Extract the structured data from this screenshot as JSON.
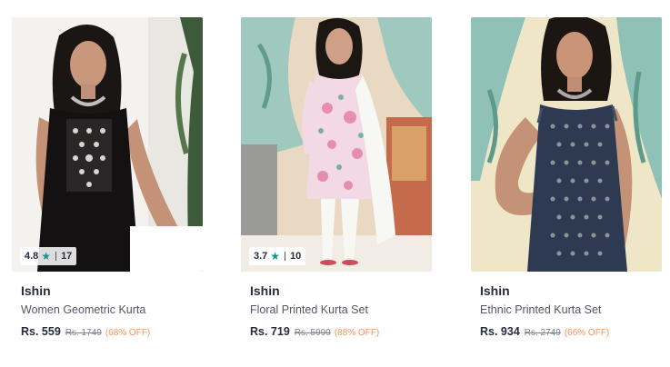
{
  "colors": {
    "brand_text": "#282c3f",
    "name_text": "#535766",
    "star": "#14958f",
    "discount": "#ff905a",
    "mrp": "#7e818c"
  },
  "icons": {
    "star": "star-icon"
  },
  "products": [
    {
      "brand": "Ishin",
      "name": "Women Geometric Kurta",
      "price": "Rs. 559",
      "mrp": "Rs. 1749",
      "discount": "(68% OFF)",
      "rating": "4.8",
      "rating_count": "17",
      "image": "model in black sleeveless embroidered kurta"
    },
    {
      "brand": "Ishin",
      "name": "Floral Printed Kurta Set",
      "price": "Rs. 719",
      "mrp": "Rs. 5999",
      "discount": "(88% OFF)",
      "rating": "3.7",
      "rating_count": "10",
      "image": "model in pink floral kurta set with white dupatta"
    },
    {
      "brand": "Ishin",
      "name": "Ethnic Printed Kurta Set",
      "price": "Rs. 934",
      "mrp": "Rs. 2749",
      "discount": "(66% OFF)",
      "image": "model in navy printed sleeveless kurta"
    }
  ]
}
